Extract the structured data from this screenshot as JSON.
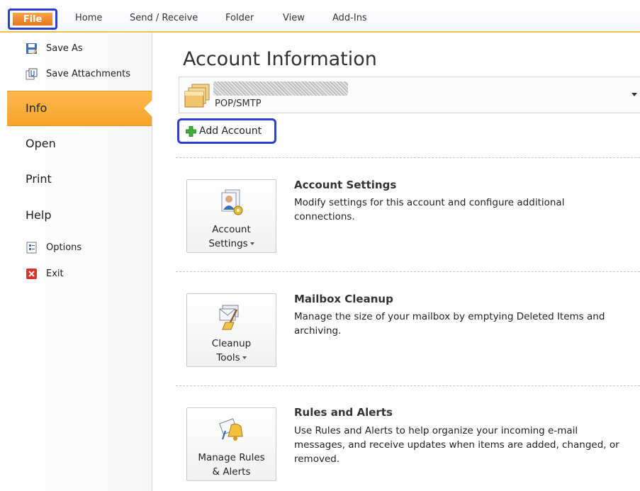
{
  "ribbon": {
    "tabs": [
      "File",
      "Home",
      "Send / Receive",
      "Folder",
      "View",
      "Add-Ins"
    ]
  },
  "nav": {
    "save_as": "Save As",
    "save_attachments": "Save Attachments",
    "info": "Info",
    "open": "Open",
    "print": "Print",
    "help": "Help",
    "options": "Options",
    "exit": "Exit"
  },
  "main": {
    "title": "Account Information",
    "account_type": "POP/SMTP",
    "add_account": "Add Account",
    "sections": [
      {
        "button_line1": "Account",
        "button_line2": "Settings",
        "heading": "Account Settings",
        "description": "Modify settings for this account and configure additional connections."
      },
      {
        "button_line1": "Cleanup",
        "button_line2": "Tools",
        "heading": "Mailbox Cleanup",
        "description": "Manage the size of your mailbox by emptying Deleted Items and archiving."
      },
      {
        "button_line1": "Manage Rules",
        "button_line2": "& Alerts",
        "heading": "Rules and Alerts",
        "description": "Use Rules and Alerts to help organize your incoming e-mail messages, and receive updates when items are added, changed, or removed."
      }
    ]
  },
  "colors": {
    "file_tab": "#e9751a",
    "selected_nav": "#f7a52a",
    "highlight_border": "#2b3fd1",
    "ribbon_accent": "#f5c342"
  }
}
